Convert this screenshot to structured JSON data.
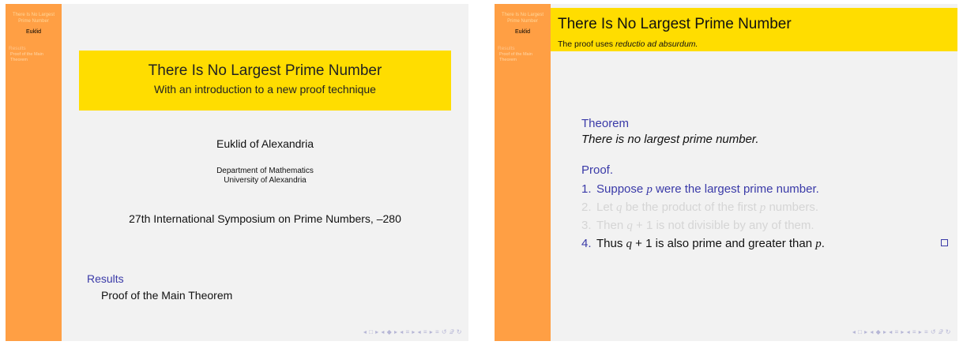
{
  "sidebar": {
    "title": "There Is No Largest Prime Number",
    "author": "Euklid",
    "section": "Results",
    "subsection": "Proof of the Main Theorem"
  },
  "slide1": {
    "title": "There Is No Largest Prime Number",
    "subtitle": "With an introduction to a new proof technique",
    "author": "Euklid of Alexandria",
    "institute_line1": "Department of Mathematics",
    "institute_line2": "University of Alexandria",
    "date": "27th International Symposium on Prime Numbers, –280",
    "toc_section": "Results",
    "toc_subsection": "Proof of the Main Theorem"
  },
  "slide2": {
    "frame_title": "There Is No Largest Prime Number",
    "frame_subtitle_prefix": "The proof uses ",
    "frame_subtitle_em": "reductio ad absurdum.",
    "theorem_heading": "Theorem",
    "theorem_body": "There is no largest prime number.",
    "proof_heading": "Proof.",
    "steps": [
      {
        "num": "1.",
        "a": "Suppose ",
        "m1": "p",
        "b": " were the largest prime number.",
        "m2": "",
        "c": ""
      },
      {
        "num": "2.",
        "a": "Let ",
        "m1": "q",
        "b": " be the product of the first ",
        "m2": "p",
        "c": " numbers."
      },
      {
        "num": "3.",
        "a": "Then ",
        "m1": "q",
        "b": " + 1 is not divisible by any of them.",
        "m2": "",
        "c": ""
      },
      {
        "num": "4.",
        "a": "Thus ",
        "m1": "q",
        "b": " + 1 is also prime and greater than ",
        "m2": "p",
        "c": "."
      }
    ]
  },
  "nav_symbols": "◂ □ ▸ ◂ ◆ ▸ ◂ ≡ ▸ ◂ ≡ ▸  ≡  ↺ 𝒬 ↻"
}
